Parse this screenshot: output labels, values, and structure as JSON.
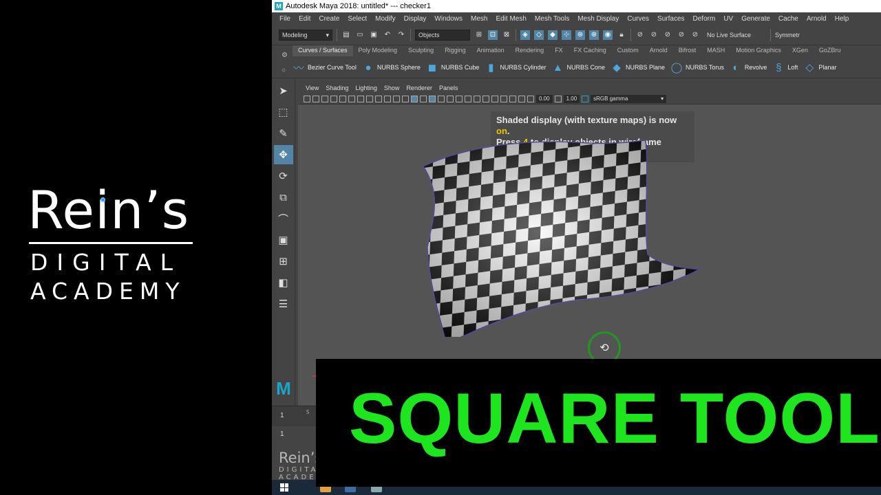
{
  "brand": {
    "title": "Rein’s",
    "line1": "DIGITAL",
    "line2": "ACADEMY"
  },
  "window": {
    "title": "Autodesk Maya 2018: untitled*   ---   checker1"
  },
  "menubar": [
    "File",
    "Edit",
    "Create",
    "Select",
    "Modify",
    "Display",
    "Windows",
    "Mesh",
    "Edit Mesh",
    "Mesh Tools",
    "Mesh Display",
    "Curves",
    "Surfaces",
    "Deform",
    "UV",
    "Generate",
    "Cache",
    "Arnold",
    "Help"
  ],
  "statusline": {
    "mode": "Modeling",
    "selection_mode": "Objects",
    "live_surface": "No Live Surface",
    "symmetry": "Symmetr"
  },
  "shelf": {
    "tabs": [
      "Curves / Surfaces",
      "Poly Modeling",
      "Sculpting",
      "Rigging",
      "Animation",
      "Rendering",
      "FX",
      "FX Caching",
      "Custom",
      "Arnold",
      "Bifrost",
      "MASH",
      "Motion Graphics",
      "XGen",
      "GoZBru"
    ],
    "tools": [
      {
        "label": "Bezier Curve Tool",
        "icon": "bezier-curve-icon"
      },
      {
        "label": "NURBS Sphere",
        "icon": "nurbs-sphere-icon"
      },
      {
        "label": "NURBS Cube",
        "icon": "nurbs-cube-icon"
      },
      {
        "label": "NURBS Cylinder",
        "icon": "nurbs-cylinder-icon"
      },
      {
        "label": "NURBS Cone",
        "icon": "nurbs-cone-icon"
      },
      {
        "label": "NURBS Plane",
        "icon": "nurbs-plane-icon"
      },
      {
        "label": "NURBS Torus",
        "icon": "nurbs-torus-icon"
      },
      {
        "label": "Revolve",
        "icon": "revolve-icon"
      },
      {
        "label": "Loft",
        "icon": "loft-icon"
      },
      {
        "label": "Planar",
        "icon": "planar-icon"
      }
    ]
  },
  "viewport": {
    "menu": [
      "View",
      "Shading",
      "Lighting",
      "Show",
      "Renderer",
      "Panels"
    ],
    "exposure": "0.00",
    "gamma": "1.00",
    "color_space": "sRGB gamma",
    "notice": {
      "line1_pre": "Shaded display (with texture maps) is now ",
      "line1_hl": "on",
      "line1_post": ".",
      "line2_pre": "Press ",
      "line2_hl": "4",
      "line2_post": " to display objects in wireframe mode."
    }
  },
  "timeline": {
    "current_frame": "1",
    "tick_label": "5",
    "range_start": "1"
  },
  "overlay": {
    "text": "SQUARE TOOL",
    "color": "#1ee61e"
  }
}
